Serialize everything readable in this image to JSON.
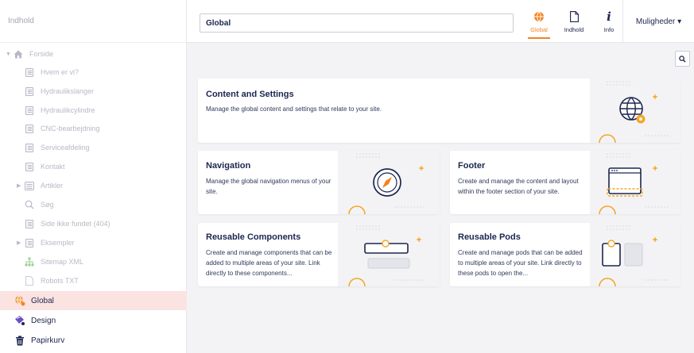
{
  "sidebar": {
    "header": "Indhold",
    "tree": [
      {
        "label": "Forside",
        "icon": "home-icon",
        "caret": true
      },
      {
        "label": "Hvem er vi?",
        "icon": "document-icon"
      },
      {
        "label": "Hydraulikslanger",
        "icon": "document-icon"
      },
      {
        "label": "Hydraulikcylindre",
        "icon": "document-icon"
      },
      {
        "label": "CNC-bearbejdning",
        "icon": "document-icon"
      },
      {
        "label": "Serviceafdeling",
        "icon": "document-icon"
      },
      {
        "label": "Kontakt",
        "icon": "document-icon"
      },
      {
        "label": "Artikler",
        "icon": "list-icon",
        "caret": true
      },
      {
        "label": "Søg",
        "icon": "search-icon"
      },
      {
        "label": "Side ikke fundet (404)",
        "icon": "document-icon"
      },
      {
        "label": "Eksempler",
        "icon": "document-icon",
        "caret": true
      },
      {
        "label": "Sitemap XML",
        "icon": "sitemap-icon"
      },
      {
        "label": "Robots TXT",
        "icon": "file-icon"
      }
    ],
    "sections": [
      {
        "label": "Global",
        "icon": "globe-icon",
        "active": true
      },
      {
        "label": "Design",
        "icon": "design-icon"
      },
      {
        "label": "Papirkurv",
        "icon": "trash-icon"
      }
    ]
  },
  "header": {
    "name_value": "Global",
    "apps": [
      {
        "label": "Global",
        "icon": "globe-icon",
        "active": true
      },
      {
        "label": "Indhold",
        "icon": "document-icon"
      },
      {
        "label": "Info",
        "icon": "info-icon"
      }
    ],
    "options_label": "Muligheder ▾"
  },
  "cards": [
    {
      "title": "Content and Settings",
      "description": "Manage the global content and settings that relate to your site.",
      "illustration": "globe-gear-icon"
    },
    {
      "title": "Navigation",
      "description": "Manage the global navigation menus of your site.",
      "illustration": "compass-icon"
    },
    {
      "title": "Footer",
      "description": "Create and manage the content and layout within the footer section of your site.",
      "illustration": "footer-layout-icon"
    },
    {
      "title": "Reusable Components",
      "description": "Create and manage components that can be added to multiple areas of your site. Link directly to these components...",
      "illustration": "components-icon"
    },
    {
      "title": "Reusable Pods",
      "description": "Create and manage pods that can be added to multiple areas of your site. Link directly to these pods to open the...",
      "illustration": "pods-icon"
    }
  ],
  "colors": {
    "accent": "#f5821f",
    "navy": "#1b264f",
    "active_bg": "#fbe3e2",
    "muted": "#b7bac6"
  }
}
